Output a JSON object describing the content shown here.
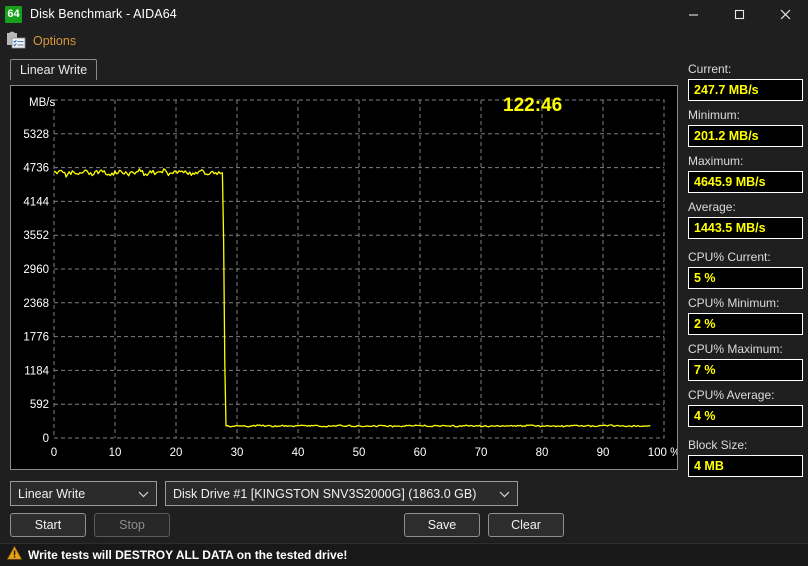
{
  "window": {
    "title": "Disk Benchmark - AIDA64",
    "app_icon": "aida64-icon",
    "icon_text": "64",
    "minimize_glyph": "—",
    "maximize_glyph": "□",
    "close_glyph": "✕"
  },
  "menu": {
    "options_label": "Options",
    "options_icon": "options-gear-checklist-icon",
    "options_color": "#d8973c"
  },
  "tabs": [
    {
      "label": "Linear Write",
      "active": true
    }
  ],
  "chart_data": {
    "type": "line",
    "title": "",
    "xlabel": "100 %",
    "ylabel": "MB/s",
    "timer": "122:46",
    "timer_color": "#ffff00",
    "line_color": "#ffff00",
    "background": "#000000",
    "grid": true,
    "grid_color": "#808080",
    "xlim": [
      0,
      100
    ],
    "ylim": [
      0,
      5920
    ],
    "xticks": [
      "0",
      "10",
      "20",
      "30",
      "40",
      "50",
      "60",
      "70",
      "80",
      "90",
      "100 %"
    ],
    "xtick_values": [
      0,
      10,
      20,
      30,
      40,
      50,
      60,
      70,
      80,
      90,
      100
    ],
    "yticks": [
      "0",
      "592",
      "1184",
      "1776",
      "2368",
      "2960",
      "3552",
      "4144",
      "4736",
      "5328"
    ],
    "ytick_values": [
      0,
      592,
      1184,
      1776,
      2368,
      2960,
      3552,
      4144,
      4736,
      5328
    ],
    "series": [
      {
        "name": "Linear Write",
        "description": "SLC cache plateau ~4650 MB/s until 28% of drive, then drop to native TLC speed ~210 MB/s",
        "x": [
          0,
          1,
          2,
          3,
          4,
          5,
          6,
          7,
          8,
          9,
          10,
          11,
          12,
          13,
          14,
          15,
          16,
          17,
          18,
          19,
          20,
          21,
          22,
          23,
          24,
          25,
          26,
          27,
          27.6,
          27.8,
          28,
          28.2,
          29,
          30,
          32,
          34,
          36,
          38,
          40,
          42,
          44,
          46,
          48,
          50,
          52,
          54,
          56,
          58,
          60,
          62,
          64,
          66,
          68,
          70,
          72,
          74,
          76,
          78,
          80,
          82,
          84,
          86,
          88,
          90,
          92,
          94,
          96,
          98,
          100
        ],
        "y": [
          4640,
          4680,
          4600,
          4665,
          4620,
          4700,
          4615,
          4655,
          4690,
          4605,
          4650,
          4675,
          4620,
          4640,
          4700,
          4610,
          4660,
          4635,
          4685,
          4615,
          4655,
          4690,
          4620,
          4645,
          4675,
          4630,
          4660,
          4640,
          4645,
          3500,
          1300,
          215,
          205,
          212,
          208,
          218,
          203,
          214,
          209,
          220,
          206,
          212,
          217,
          204,
          210,
          215,
          202,
          211,
          219,
          207,
          213,
          205,
          216,
          209,
          203,
          214,
          210,
          218,
          206,
          212,
          204,
          215,
          209,
          211,
          217,
          203,
          210,
          214
        ]
      }
    ]
  },
  "stats": [
    {
      "label": "Current:",
      "value": "247.7 MB/s",
      "name": "current"
    },
    {
      "label": "Minimum:",
      "value": "201.2 MB/s",
      "name": "minimum"
    },
    {
      "label": "Maximum:",
      "value": "4645.9 MB/s",
      "name": "maximum"
    },
    {
      "label": "Average:",
      "value": "1443.5 MB/s",
      "name": "average"
    },
    {
      "label": "CPU% Current:",
      "value": "5 %",
      "name": "cpu-current"
    },
    {
      "label": "CPU% Minimum:",
      "value": "2 %",
      "name": "cpu-minimum"
    },
    {
      "label": "CPU% Maximum:",
      "value": "7 %",
      "name": "cpu-maximum"
    },
    {
      "label": "CPU% Average:",
      "value": "4 %",
      "name": "cpu-average"
    },
    {
      "label": "Block Size:",
      "value": "4 MB",
      "name": "block-size"
    }
  ],
  "selectors": {
    "test_type": "Linear Write",
    "drive": "Disk Drive #1  [KINGSTON SNV3S2000G]  (1863.0 GB)"
  },
  "buttons": {
    "start": "Start",
    "stop": "Stop",
    "save": "Save",
    "clear": "Clear"
  },
  "warning": {
    "icon": "warning-triangle-icon",
    "text": "Write tests will DESTROY ALL DATA on the tested drive!",
    "color": "#e8a317"
  }
}
